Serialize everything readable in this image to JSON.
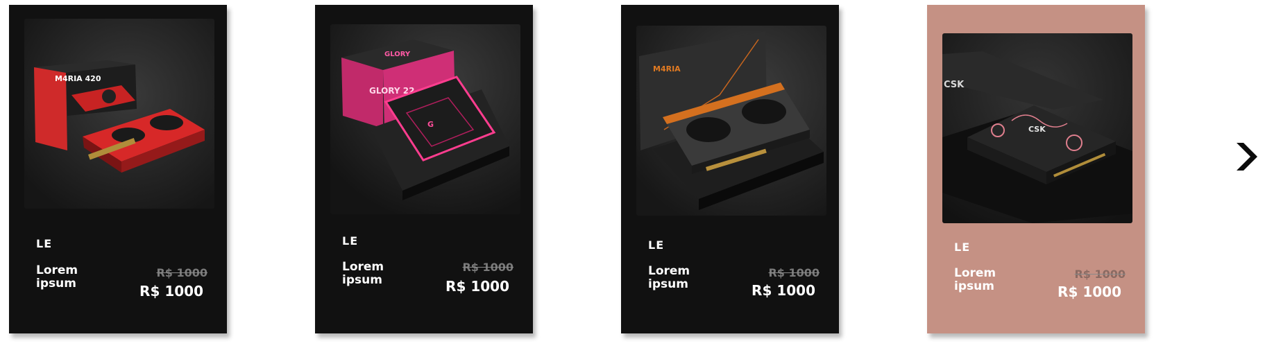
{
  "carousel": {
    "next_icon": "chevron-right-icon",
    "cards": [
      {
        "label": "LE",
        "name": "Lorem ipsum",
        "old_price": "R$ 1000",
        "price": "R$ 1000",
        "bg_color": "#111111",
        "product_image": "red graphics card with box",
        "box_text": "M4RIA 420"
      },
      {
        "label": "LE",
        "name": "Lorem ipsum",
        "old_price": "R$ 1000",
        "price": "R$ 1000",
        "bg_color": "#111111",
        "product_image": "pink black console in box",
        "box_text": "GLORY 22",
        "box_brand": "GLORY"
      },
      {
        "label": "LE",
        "name": "Lorem ipsum",
        "old_price": "R$ 1000",
        "price": "R$ 1000",
        "bg_color": "#111111",
        "product_image": "orange black graphics card in box",
        "box_text": "M4RIA"
      },
      {
        "label": "LE",
        "name": "Lorem ipsum",
        "old_price": "R$ 1000",
        "price": "R$ 1000",
        "bg_color": "#c59184",
        "product_image": "rose patterned console in box",
        "box_text": "CSK"
      }
    ]
  },
  "colors": {
    "card_dark": "#111111",
    "card_highlight": "#c59184",
    "old_price": "#7a7a7a",
    "text": "#ffffff"
  }
}
